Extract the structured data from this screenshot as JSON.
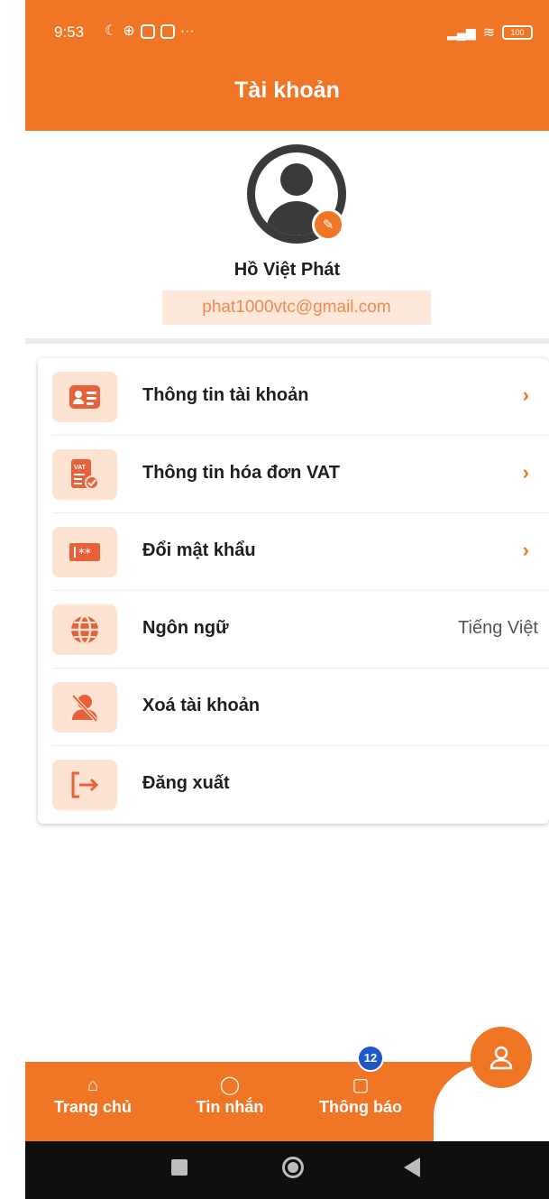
{
  "status": {
    "time": "9:53",
    "battery": "100"
  },
  "header": {
    "title": "Tài khoản"
  },
  "profile": {
    "name": "Hồ Việt Phát",
    "email": "phat1000vtc@gmail.com"
  },
  "menu": {
    "items": [
      {
        "label": "Thông tin tài khoản",
        "icon": "id-card-icon",
        "chevron": "›"
      },
      {
        "label": "Thông tin hóa đơn VAT",
        "icon": "vat-invoice-icon",
        "chevron": "›"
      },
      {
        "label": "Đổi mật khẩu",
        "icon": "password-icon",
        "chevron": "›"
      },
      {
        "label": "Ngôn ngữ",
        "icon": "globe-icon",
        "value": "Tiếng Việt"
      },
      {
        "label": "Xoá tài khoản",
        "icon": "delete-account-icon"
      },
      {
        "label": "Đăng xuất",
        "icon": "logout-icon"
      }
    ]
  },
  "bottom_nav": {
    "items": [
      {
        "label": "Trang chủ",
        "icon": "home-icon"
      },
      {
        "label": "Tin nhắn",
        "icon": "chat-icon"
      },
      {
        "label": "Thông báo",
        "icon": "bell-icon"
      }
    ],
    "notification_count": "12",
    "active": "profile"
  },
  "colors": {
    "accent": "#f07625",
    "badge": "#1f58c9"
  }
}
